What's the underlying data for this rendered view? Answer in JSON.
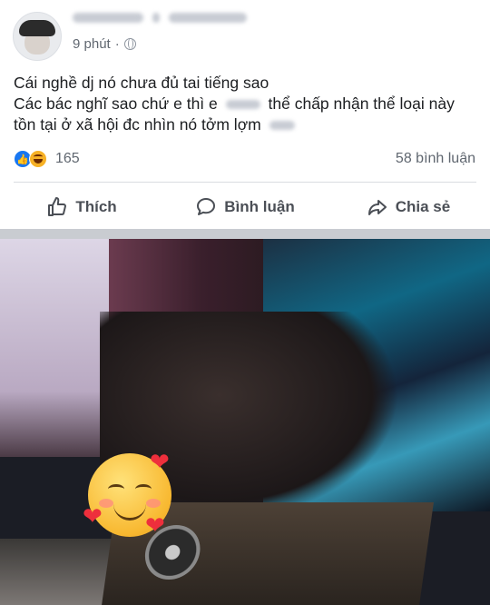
{
  "post": {
    "time": "9 phút",
    "lines": [
      "Cái nghề dj nó chưa đủ tai tiếng sao",
      [
        "Các bác nghĩ sao chứ e thì e",
        "thể chấp nhận thể loại này"
      ],
      [
        "tồn tại ở xã hội đc nhìn nó tởm lợm"
      ]
    ]
  },
  "stats": {
    "reactions": "165",
    "comments": "58 bình luận"
  },
  "actions": {
    "like": "Thích",
    "comment": "Bình luận",
    "share": "Chia sẻ"
  },
  "icons": [
    "globe-icon",
    "like-icon",
    "haha-icon",
    "thumbs-up-icon",
    "comment-icon",
    "share-icon",
    "smiling-emoji-sticker",
    "heart-icon"
  ],
  "colors": {
    "like_blue": "#1877f2",
    "text": "#1c1e21",
    "muted": "#606770",
    "separator": "#c9ccd1"
  }
}
